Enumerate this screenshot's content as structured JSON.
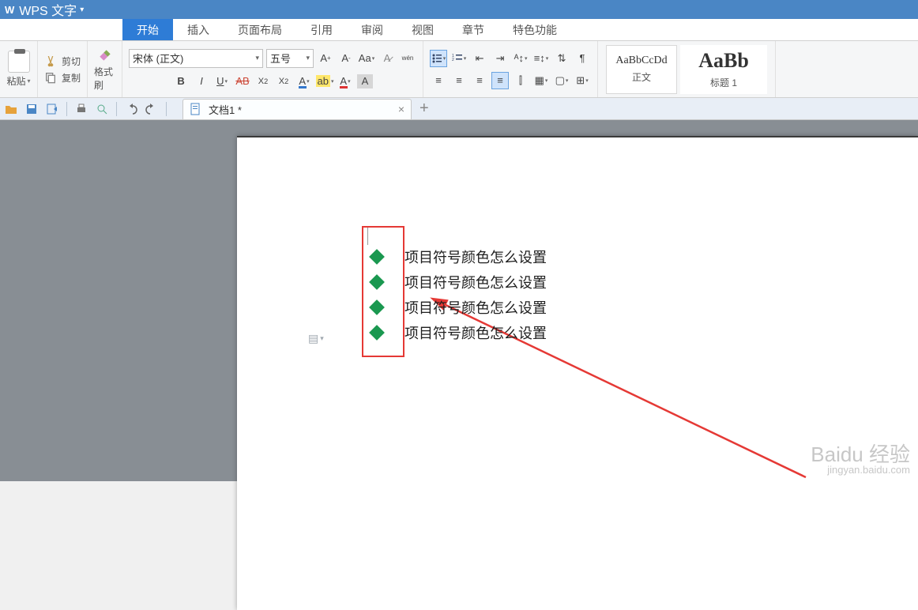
{
  "title_bar": {
    "app_name": "WPS 文字"
  },
  "menu_tabs": {
    "items": [
      "开始",
      "插入",
      "页面布局",
      "引用",
      "审阅",
      "视图",
      "章节",
      "特色功能"
    ],
    "active_index": 0
  },
  "ribbon": {
    "paste_label": "粘贴",
    "cut_label": "剪切",
    "copy_label": "复制",
    "format_painter_label": "格式刷",
    "font_name": "宋体 (正文)",
    "font_size": "五号"
  },
  "styles": {
    "items": [
      {
        "preview": "AaBbCcDd",
        "name": "正文",
        "size": "sm"
      },
      {
        "preview": "AaBb",
        "name": "标题 1",
        "size": "lg"
      }
    ]
  },
  "doc_tab": {
    "title": "文档1 *"
  },
  "document": {
    "bullets": [
      "项目符号颜色怎么设置",
      "项目符号颜色怎么设置",
      "项目符号颜色怎么设置",
      "项目符号颜色怎么设置"
    ]
  },
  "colors": {
    "accent": "#2e7cd6",
    "bullet": "#1a9850",
    "annotation": "#e53935"
  },
  "watermark": {
    "main": "Baidu 经验",
    "sub": "jingyan.baidu.com"
  }
}
